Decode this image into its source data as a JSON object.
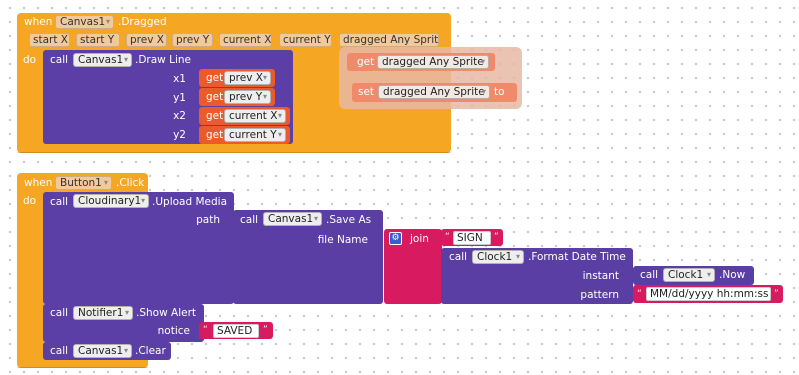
{
  "colors": {
    "event_block": "#f5a623",
    "method_call": "#5b3fa6",
    "getter": "#ea5a2b",
    "text": "#d81b60"
  },
  "dropdown_arrow": "▾",
  "event1": {
    "when": "when",
    "component": "Canvas1",
    "event": ".Dragged",
    "params": [
      "start X",
      "start Y",
      "prev X",
      "prev Y",
      "current X",
      "current Y",
      "dragged Any Sprite"
    ],
    "do": "do",
    "call": "call",
    "call_component": "Canvas1",
    "method": ".Draw Line",
    "args": [
      {
        "name": "x1",
        "get": "get",
        "var": "prev X"
      },
      {
        "name": "y1",
        "get": "get",
        "var": "prev Y"
      },
      {
        "name": "x2",
        "get": "get",
        "var": "current X"
      },
      {
        "name": "y2",
        "get": "get",
        "var": "current Y"
      }
    ]
  },
  "floating": {
    "get_label": "get",
    "get_var": "dragged Any Sprite",
    "set_label": "set",
    "set_var": "dragged Any Sprite",
    "to": "to"
  },
  "event2": {
    "when": "when",
    "component": "Button1",
    "event": ".Click",
    "do": "do",
    "upload": {
      "call": "call",
      "component": "Cloudinary1",
      "method": ".Upload Media",
      "arg": "path"
    },
    "save": {
      "call": "call",
      "component": "Canvas1",
      "method": ".Save As",
      "arg": "file Name"
    },
    "join": {
      "label": "join",
      "text1": "SIGN"
    },
    "format": {
      "call": "call",
      "component": "Clock1",
      "method": ".Format Date Time",
      "arg_instant": "instant",
      "arg_pattern": "pattern"
    },
    "now": {
      "call": "call",
      "component": "Clock1",
      "method": ".Now"
    },
    "pattern_text": "MM/dd/yyyy hh:mm:ss a",
    "alert": {
      "call": "call",
      "component": "Notifier1",
      "method": ".Show Alert",
      "arg": "notice",
      "text": "SAVED"
    },
    "clear": {
      "call": "call",
      "component": "Canvas1",
      "method": ".Clear"
    },
    "quote_open": "“",
    "quote_close": "”"
  }
}
